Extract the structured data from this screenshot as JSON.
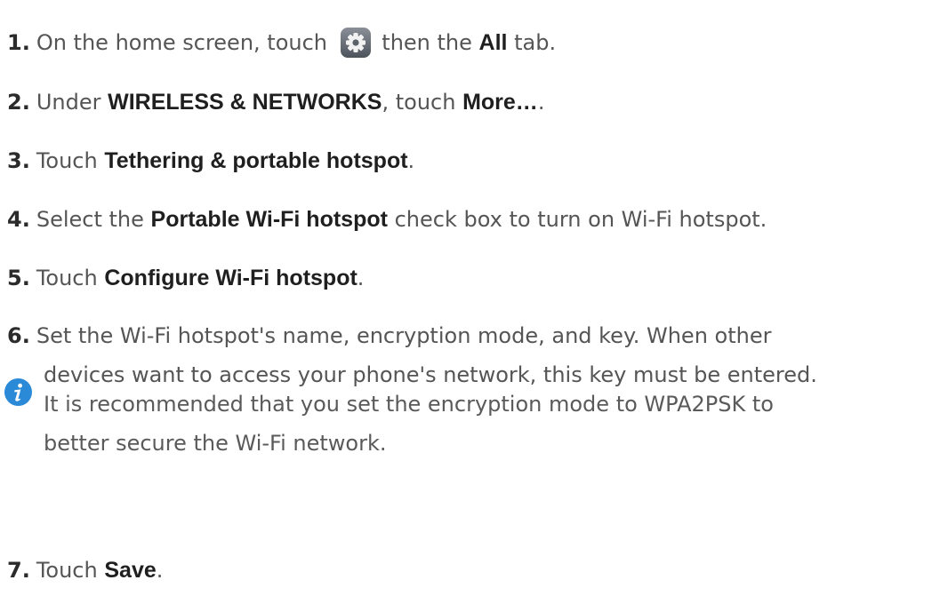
{
  "steps": [
    {
      "num": "1.",
      "parts": {
        "a": "On the home screen, touch",
        "icon": "settings-gear-icon",
        "b": "then the",
        "bold1": "All",
        "c": "tab."
      }
    },
    {
      "num": "2.",
      "parts": {
        "a": "Under",
        "bold1": "WIRELESS & NETWORKS",
        "b": ", touch",
        "bold2": "More…",
        "c": "."
      }
    },
    {
      "num": "3.",
      "parts": {
        "a": "Touch",
        "bold1": "Tethering & portable hotspot",
        "b": "."
      }
    },
    {
      "num": "4.",
      "parts": {
        "a": "Select the",
        "bold1": "Portable Wi-Fi hotspot",
        "b": "check box to turn on Wi-Fi hotspot."
      }
    },
    {
      "num": "5.",
      "parts": {
        "a": "Touch",
        "bold1": "Configure Wi-Fi hotspot",
        "b": "."
      }
    },
    {
      "num": "6.",
      "parts": {
        "line1": "Set the Wi-Fi hotspot's name, encryption mode, and key. When other",
        "line2": "devices want to access your phone's network, this key must be entered."
      }
    },
    {
      "num": "7.",
      "parts": {
        "a": "Touch",
        "bold1": "Save",
        "b": "."
      }
    }
  ],
  "note": {
    "icon": "info-icon",
    "icon_color": "#2a8ad8",
    "line1": "It is recommended that you set the encryption mode to WPA2PSK to",
    "line2": "better secure the Wi-Fi network."
  }
}
